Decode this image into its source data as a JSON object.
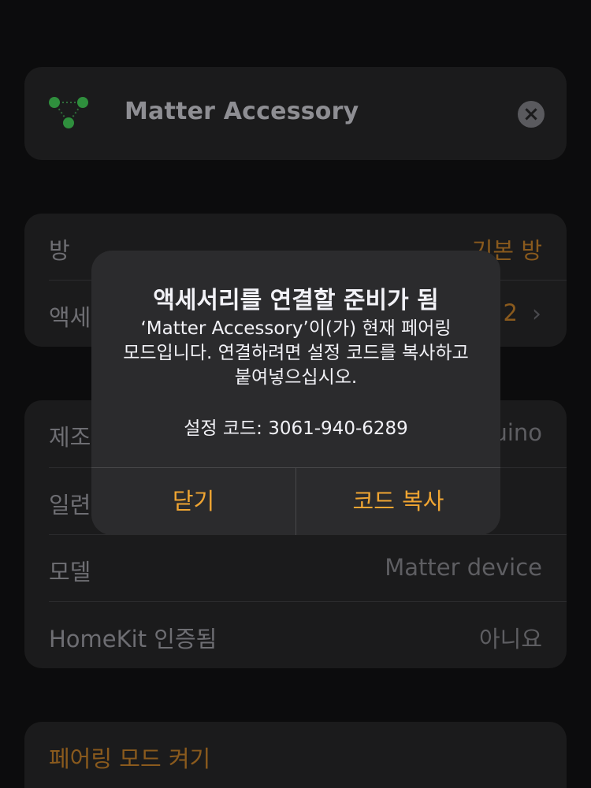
{
  "header": {
    "title": "Matter Accessory",
    "icon": "matter-logo-icon",
    "clear_icon": "×"
  },
  "room_section": {
    "room_label": "방",
    "room_value": "기본 방",
    "accessory_label_partial": "액세",
    "accessory_value_partial": "2"
  },
  "info_section": {
    "manufacturer_label_partial": "제조",
    "manufacturer_value_partial": "uino",
    "serial_label_partial": "일련",
    "model_label": "모델",
    "model_value": "Matter device",
    "homekit_label": "HomeKit 인증됨",
    "homekit_value": "아니요"
  },
  "pairing": {
    "label": "페어링 모드 켜기"
  },
  "alert": {
    "title": "액세서리를 연결할 준비가 됨",
    "message": "‘Matter Accessory’이(가) 현재 페어링\n모드입니다. 연결하려면 설정 코드를 복사하고\n붙여넣으십시오.",
    "code": "설정 코드: 3061-940-6289",
    "close_button": "닫기",
    "copy_button": "코드 복사"
  },
  "colors": {
    "accent": "#f0a532",
    "background": "#0c0c0d",
    "alert_background": "#2b2b2d"
  }
}
